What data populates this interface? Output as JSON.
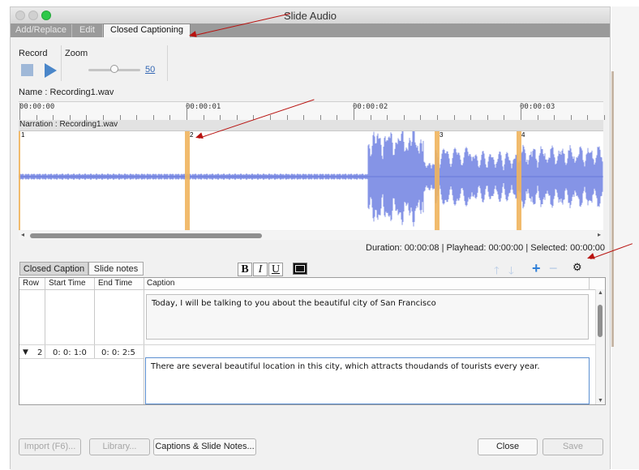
{
  "window": {
    "title": "Slide Audio"
  },
  "tabs": [
    {
      "label": "Add/Replace",
      "active": false
    },
    {
      "label": "Edit",
      "active": false
    },
    {
      "label": "Closed Captioning",
      "active": true
    }
  ],
  "record": {
    "label": "Record",
    "stop_icon": "stop-icon",
    "play_icon": "play-icon"
  },
  "zoom": {
    "label": "Zoom",
    "value": "50",
    "slider_level": 0.5
  },
  "file": {
    "name_line": "Name :  Recording1.wav"
  },
  "timeline": {
    "ticks": [
      "00:00:00",
      "00:00:01",
      "00:00:02",
      "00:00:03"
    ]
  },
  "narration": {
    "label": "Narration : Recording1.wav",
    "markers": [
      "1",
      "2",
      "3",
      "4"
    ]
  },
  "status": {
    "text": "Duration:  00:00:08 | Playhead:  00:00:00 | Selected:  00:00:00"
  },
  "segments": {
    "closed_caption": "Closed Caption",
    "slide_notes": "Slide notes"
  },
  "format": {
    "bold": "B",
    "italic": "I",
    "underline": "U"
  },
  "table": {
    "headers": {
      "row": "Row",
      "start": "Start Time",
      "end": "End Time",
      "caption": "Caption"
    },
    "rows": [
      {
        "row": "",
        "start": "",
        "end": "",
        "caption": "Today, I will be talking to you about the beautiful city of San Francisco"
      },
      {
        "row": "2",
        "start": "0: 0: 1:0",
        "end": "0: 0: 2:5",
        "caption": "There are several beautiful location in this city, which attracts thoudands of tourists every year."
      }
    ]
  },
  "buttons": {
    "import": "Import (F6)...",
    "library": "Library...",
    "captions_notes": "Captions & Slide Notes...",
    "close": "Close",
    "save": "Save"
  },
  "colors": {
    "wave": "#8594e6",
    "marker": "#f0b45d",
    "annotation": "#b8120f",
    "add": "#2f7fd8"
  }
}
